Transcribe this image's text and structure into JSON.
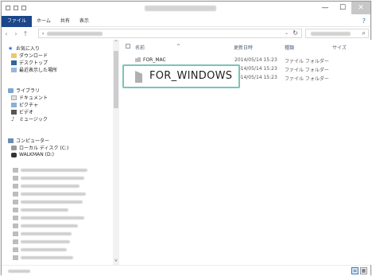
{
  "ribbon": {
    "file_tab": "ファイル",
    "tabs": [
      "ホーム",
      "共有",
      "表示"
    ]
  },
  "address": {
    "back_icon": "‹",
    "forward_icon": "›",
    "up_icon": "↑",
    "separator": "›",
    "dropdown_icon": "⌄",
    "refresh_icon": "↻",
    "search_icon": "⌕"
  },
  "nav": {
    "favorites": {
      "label": "お気に入り",
      "items": [
        "ダウンロード",
        "デスクトップ",
        "最近表示した場所"
      ]
    },
    "libraries": {
      "label": "ライブラリ",
      "items": [
        "ドキュメント",
        "ピクチャ",
        "ビデオ",
        "ミュージック"
      ]
    },
    "computer": {
      "label": "コンピューター",
      "items": [
        "ローカル ディスク (C:)",
        "WALKMAN (D:)"
      ]
    },
    "scroll_up": "^",
    "scroll_down": "v"
  },
  "columns": {
    "name": "名前",
    "date": "更新日時",
    "type": "種類",
    "size": "サイズ"
  },
  "files": [
    {
      "name": "FOR_MAC",
      "date": "2014/05/14 15:23",
      "type": "ファイル フォルダー"
    },
    {
      "name": "FOR_WINDOWS",
      "date": "2014/05/14 15:23",
      "type": "ファイル フォルダー"
    }
  ],
  "window_buttons": {
    "minimize": "—",
    "maximize": "☐",
    "close": "✕"
  },
  "ribbon_help": "?"
}
